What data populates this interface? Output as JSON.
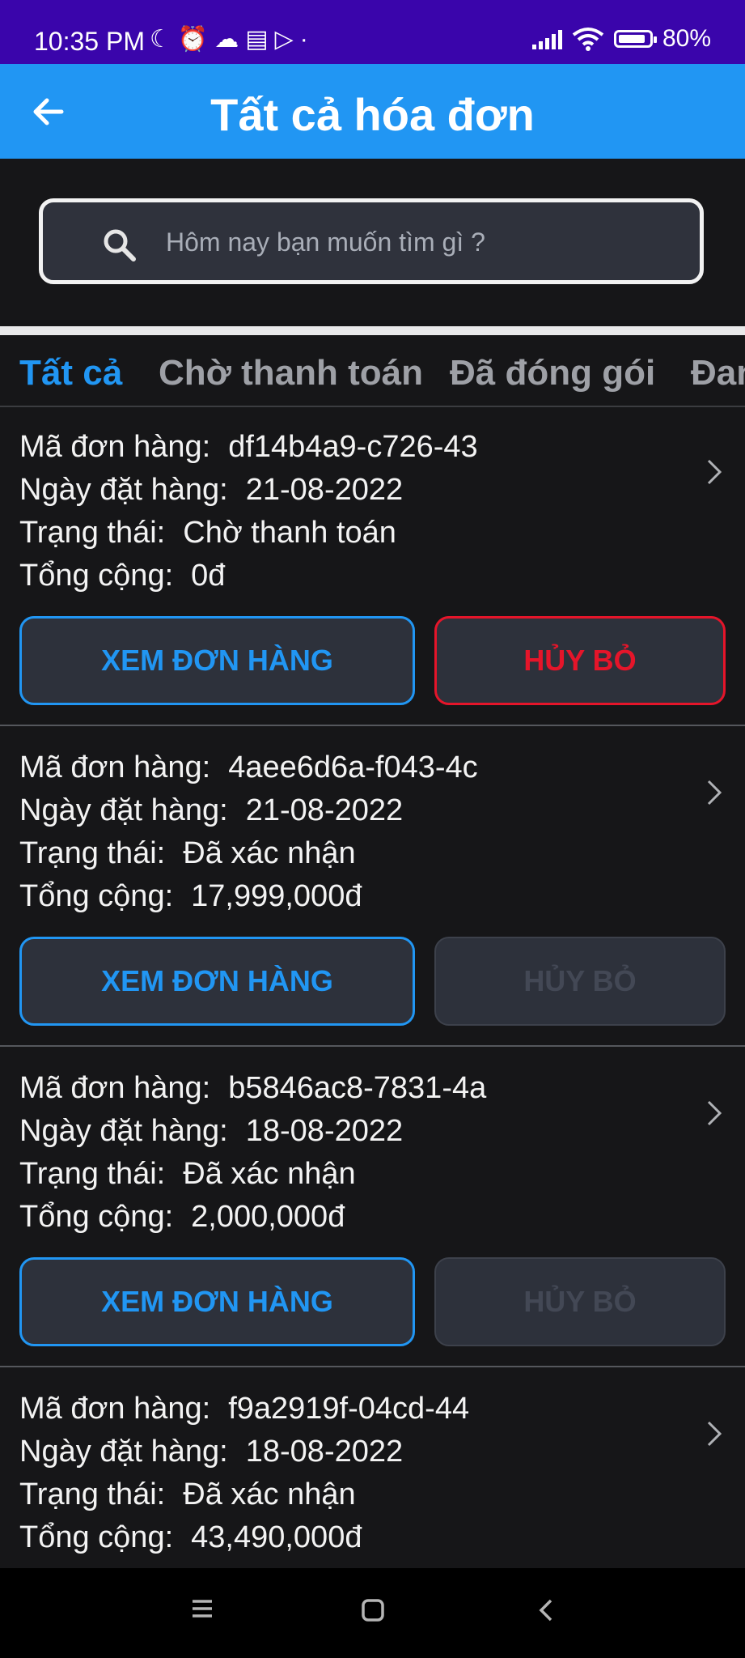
{
  "status_bar": {
    "time": "10:35 PM",
    "icons": [
      "moon-icon",
      "alarm-icon",
      "cloud-icon",
      "news-icon",
      "play-icon",
      "dot-icon"
    ],
    "battery": "80%"
  },
  "app_bar": {
    "title": "Tất cả hóa đơn",
    "back_icon": "arrow-left-icon"
  },
  "search": {
    "placeholder": "Hôm nay bạn muốn tìm gì ?"
  },
  "tabs": [
    {
      "label": "Tất cả",
      "active": true
    },
    {
      "label": "Chờ thanh toán",
      "active": false
    },
    {
      "label": "Đã đóng gói",
      "active": false
    },
    {
      "label": "Đan",
      "active": false
    }
  ],
  "labels": {
    "order_id": "Mã đơn hàng:",
    "order_date": "Ngày đặt hàng:",
    "status": "Trạng thái:",
    "total": "Tổng cộng:",
    "view_button": "XEM ĐƠN HÀNG",
    "cancel_button": "HỦY BỎ"
  },
  "orders": [
    {
      "id": "df14b4a9-c726-43",
      "date": "21-08-2022",
      "status": "Chờ thanh toán",
      "total": "0đ",
      "cancel_enabled": true
    },
    {
      "id": "4aee6d6a-f043-4c",
      "date": "21-08-2022",
      "status": "Đã xác nhận",
      "total": "17,999,000đ",
      "cancel_enabled": false
    },
    {
      "id": "b5846ac8-7831-4a",
      "date": "18-08-2022",
      "status": "Đã xác nhận",
      "total": "2,000,000đ",
      "cancel_enabled": false
    },
    {
      "id": "f9a2919f-04cd-44",
      "date": "18-08-2022",
      "status": "Đã xác nhận",
      "total": "43,490,000đ",
      "cancel_enabled": false
    }
  ],
  "colors": {
    "accent": "#2196f3",
    "status_bar": "#3a05ab",
    "danger": "#e5152a",
    "background": "#161618"
  },
  "nav_bar": {
    "icons": [
      "menu-icon",
      "home-icon",
      "back-icon"
    ]
  }
}
